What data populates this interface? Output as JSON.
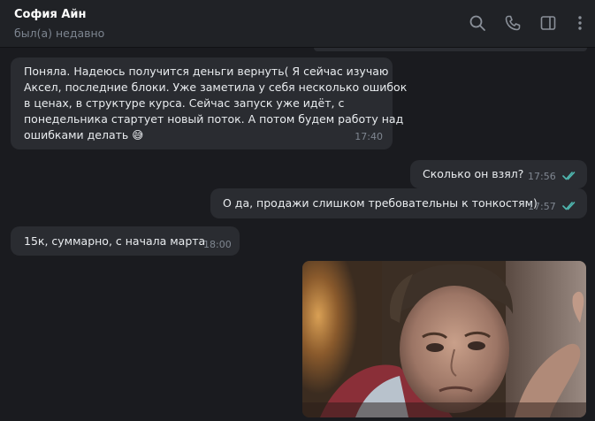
{
  "header": {
    "name": "София Айн",
    "status": "был(а) недавно",
    "icons": [
      "search-icon",
      "phone-icon",
      "sidebar-toggle-icon",
      "more-vertical-icon"
    ]
  },
  "messages": [
    {
      "direction": "incoming",
      "lines": [
        "Поняла. Надеюсь получится деньги вернуть( Я сейчас изучаю",
        "Аксел, последние блоки. Уже заметила у себя несколько ошибок",
        "в ценах, в структуре курса. Сейчас запуск уже идёт, с",
        "понедельника стартует новый поток. А потом будем работу над",
        "ошибками делать 😅"
      ],
      "time": "17:40"
    },
    {
      "direction": "outgoing",
      "text": "Сколько он взял?",
      "time": "17:56",
      "read": true
    },
    {
      "direction": "outgoing",
      "text": "О да, продажи слишком требовательны к тонкостям)",
      "time": "17:57",
      "read": true
    },
    {
      "direction": "incoming",
      "text": "15к, суммарно, с начала марта",
      "time": "18:00"
    },
    {
      "direction": "outgoing",
      "type": "photo"
    }
  ],
  "colors": {
    "background": "#1a1b1f",
    "header": "#202226",
    "bubble": "#2a2c31",
    "check": "#4fb8b0",
    "time": "#7f8690"
  }
}
